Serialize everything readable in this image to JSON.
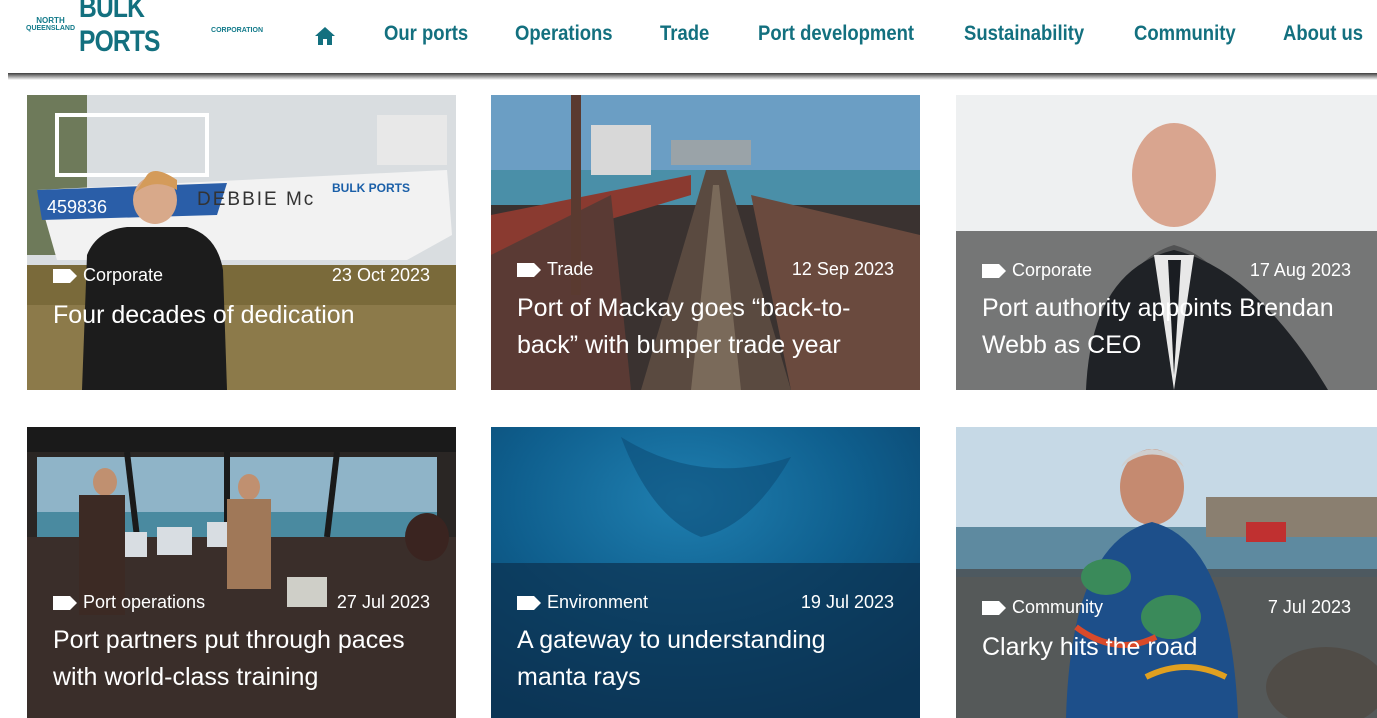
{
  "logo": {
    "top_left": "NORTH",
    "bottom_left": "QUEENSLAND",
    "main": "BULK PORTS",
    "right": "CORPORATION"
  },
  "nav": {
    "items": [
      {
        "label": "Our ports"
      },
      {
        "label": "Operations"
      },
      {
        "label": "Trade"
      },
      {
        "label": "Port development"
      },
      {
        "label": "Sustainability"
      },
      {
        "label": "Community"
      },
      {
        "label": "About us"
      }
    ]
  },
  "cards": [
    {
      "category": "Corporate",
      "date": "23 Oct 2023",
      "title": "Four decades of dedication",
      "boat_number": "459836",
      "boat_name": "DEBBIE Mc",
      "boat_brand": "BULK PORTS"
    },
    {
      "category": "Trade",
      "date": "12 Sep 2023",
      "title": "Port of Mackay goes “back-to-back” with bumper trade year"
    },
    {
      "category": "Corporate",
      "date": "17 Aug 2023",
      "title": "Port authority appoints Brendan Webb as CEO"
    },
    {
      "category": "Port operations",
      "date": "27 Jul 2023",
      "title": "Port partners put through paces with world-class training"
    },
    {
      "category": "Environment",
      "date": "19 Jul 2023",
      "title": "A gateway to understanding manta rays"
    },
    {
      "category": "Community",
      "date": "7 Jul 2023",
      "title": "Clarky hits the road"
    }
  ],
  "colors": {
    "brand_teal": "#13707f",
    "overlay": "rgba(70,70,70,0.72)"
  }
}
